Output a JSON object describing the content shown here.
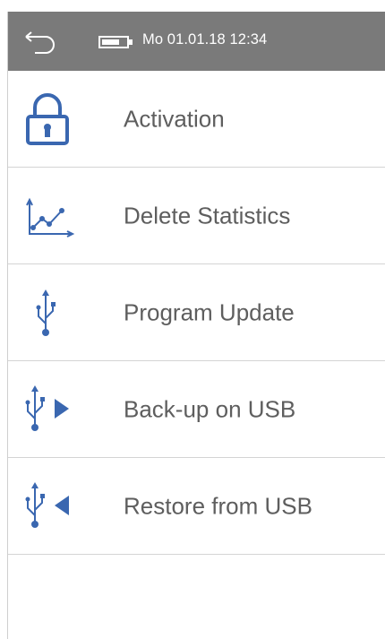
{
  "status_bar": {
    "datetime": "Mo 01.01.18  12:34",
    "icons": [
      "back-arrow-icon",
      "battery-icon"
    ]
  },
  "menu": {
    "items": [
      {
        "label": "Activation",
        "icon": "padlock-icon"
      },
      {
        "label": "Delete Statistics",
        "icon": "statistics-chart-icon"
      },
      {
        "label": "Program Update",
        "icon": "usb-icon"
      },
      {
        "label": "Back-up on USB",
        "icon": "usb-export-icon"
      },
      {
        "label": "Restore from USB",
        "icon": "usb-import-icon"
      }
    ]
  },
  "colors": {
    "status_bar_bg": "#7a7a7a",
    "icon_blue": "#3a67b0",
    "label_text": "#5e5e5e",
    "divider": "#d4d4d4"
  }
}
